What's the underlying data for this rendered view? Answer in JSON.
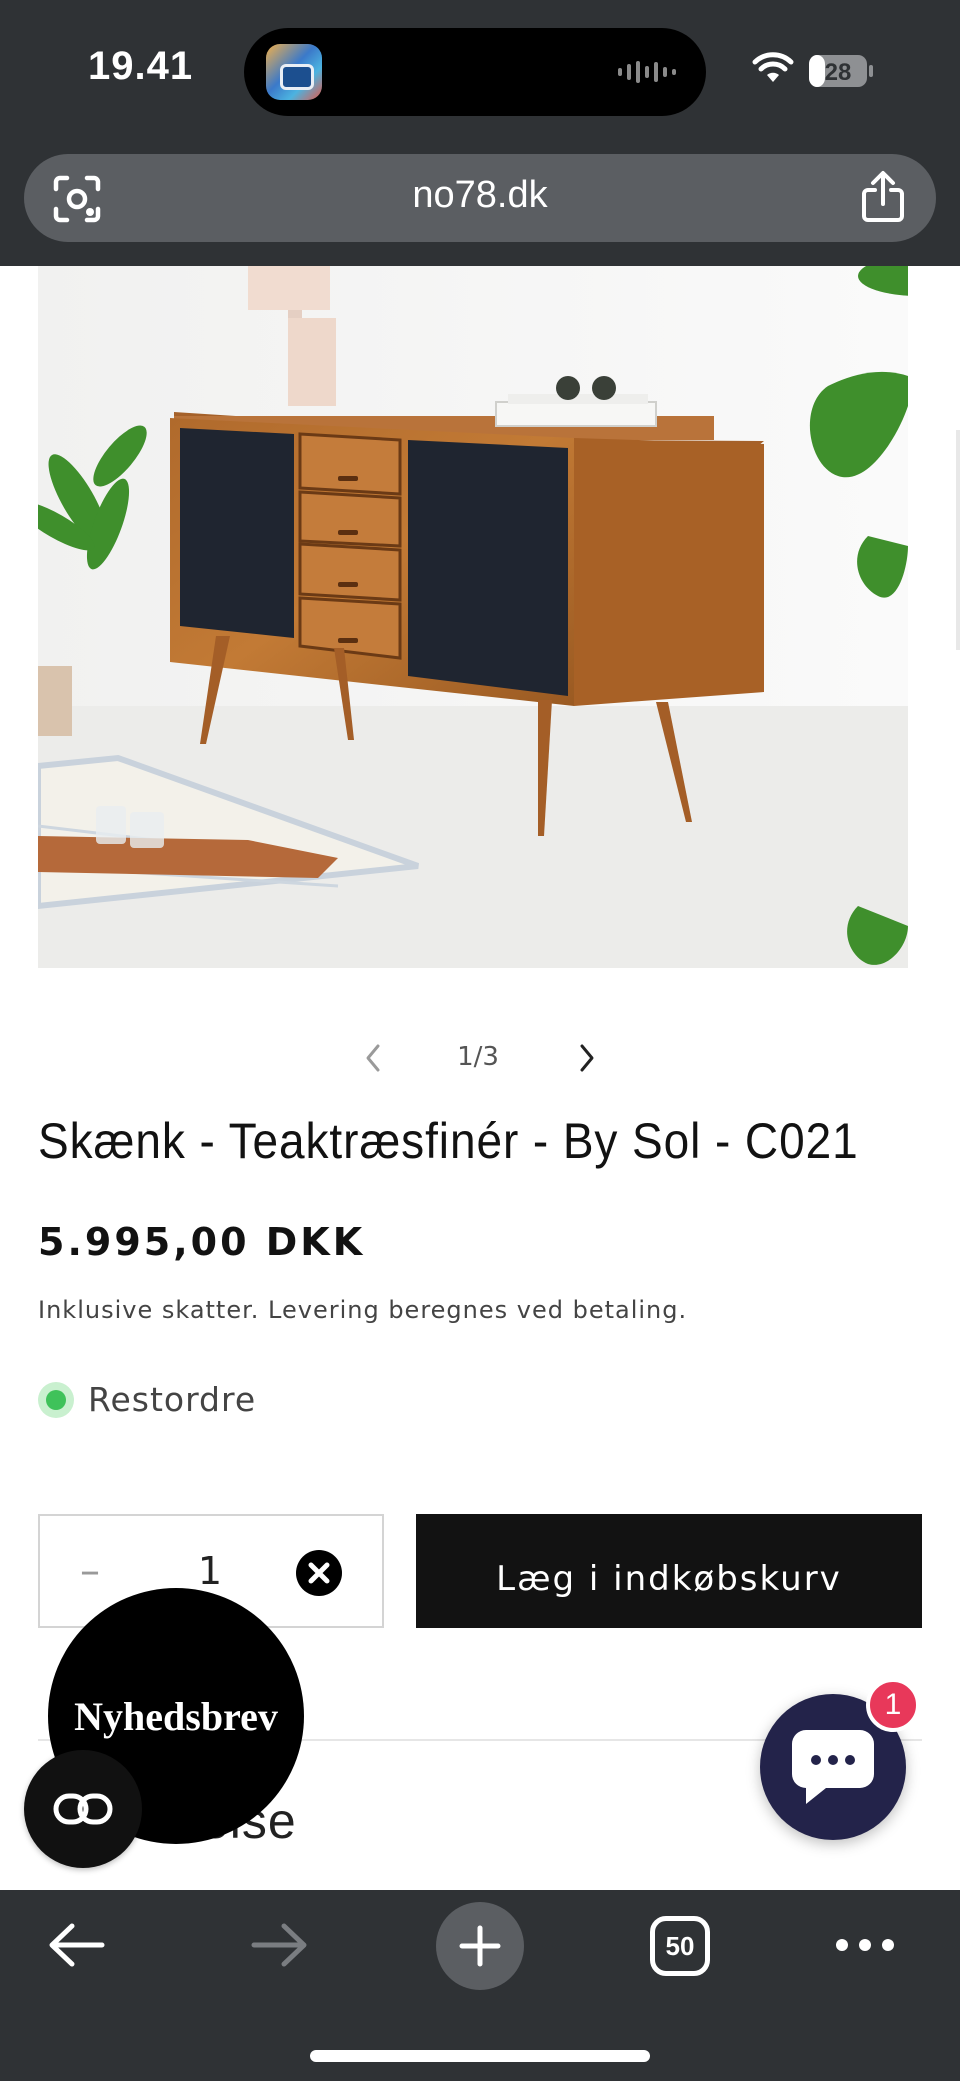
{
  "status_bar": {
    "time": "19.41",
    "battery_level": "28"
  },
  "browser": {
    "url": "no78.dk",
    "open_tabs": "50"
  },
  "carousel": {
    "counter": "1/3"
  },
  "product": {
    "title": "Skænk - Teaktræsfinér - By Sol - C021",
    "price": "5.995,00 DKK",
    "tax_note": "Inklusive skatter. Levering beregnes ved betaling.",
    "stock_status": "Restordre",
    "stock_color": "#3fc25a",
    "quantity": "1",
    "quantity_minus": "–",
    "add_to_cart": "Læg i indkøbskurv"
  },
  "partial_section_label": "krivelse",
  "newsletter_label": "Nyhedsbrev",
  "chat": {
    "badge_count": "1",
    "color": "#23234a"
  },
  "icons": [
    "lens-icon",
    "share-icon",
    "chevron-left-icon",
    "chevron-right-icon",
    "clear-icon",
    "link-icon",
    "chat-icon",
    "back-arrow-icon",
    "forward-arrow-icon",
    "plus-icon",
    "more-icon"
  ]
}
